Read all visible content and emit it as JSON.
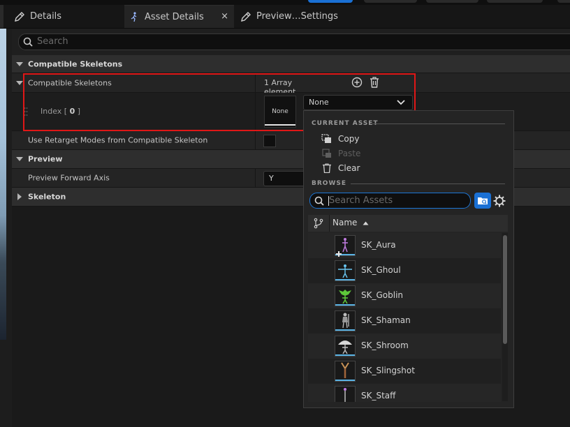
{
  "tabs": [
    {
      "label": "Details",
      "icon": "pencil-icon"
    },
    {
      "label": "Asset Details",
      "icon": "skeleton-running-icon",
      "close": "×"
    },
    {
      "label": "Preview…Settings",
      "icon": "pencil-icon"
    }
  ],
  "search": {
    "placeholder": "Search"
  },
  "details": {
    "category_compatible": "Compatible Skeletons",
    "prop_compatible": "Compatible Skeletons",
    "array_count": "1 Array element",
    "index_label_prefix": "Index [ ",
    "index_value": "0",
    "index_label_suffix": " ]",
    "thumbnail_text": "None",
    "combo_value": "None",
    "use_retarget_label": "Use Retarget Modes from Compatible Skeleton",
    "use_retarget_checked": false,
    "category_preview": "Preview",
    "preview_forward_axis_label": "Preview Forward Axis",
    "preview_forward_axis_value": "Y",
    "category_skeleton": "Skeleton"
  },
  "popup": {
    "current_asset_header": "CURRENT ASSET",
    "copy": "Copy",
    "paste": "Paste",
    "clear": "Clear",
    "browse_header": "BROWSE",
    "search_placeholder": "Search Assets",
    "column_name": "Name",
    "sort": "ascending",
    "assets": [
      "SK_Aura",
      "SK_Ghoul",
      "SK_Goblin",
      "SK_Shaman",
      "SK_Shroom",
      "SK_Slingshot",
      "SK_Staff"
    ]
  },
  "colors": {
    "accent_blue": "#1a70d4",
    "highlight_red": "#e01717",
    "thumbnail_underline": "#5ab4e6"
  }
}
